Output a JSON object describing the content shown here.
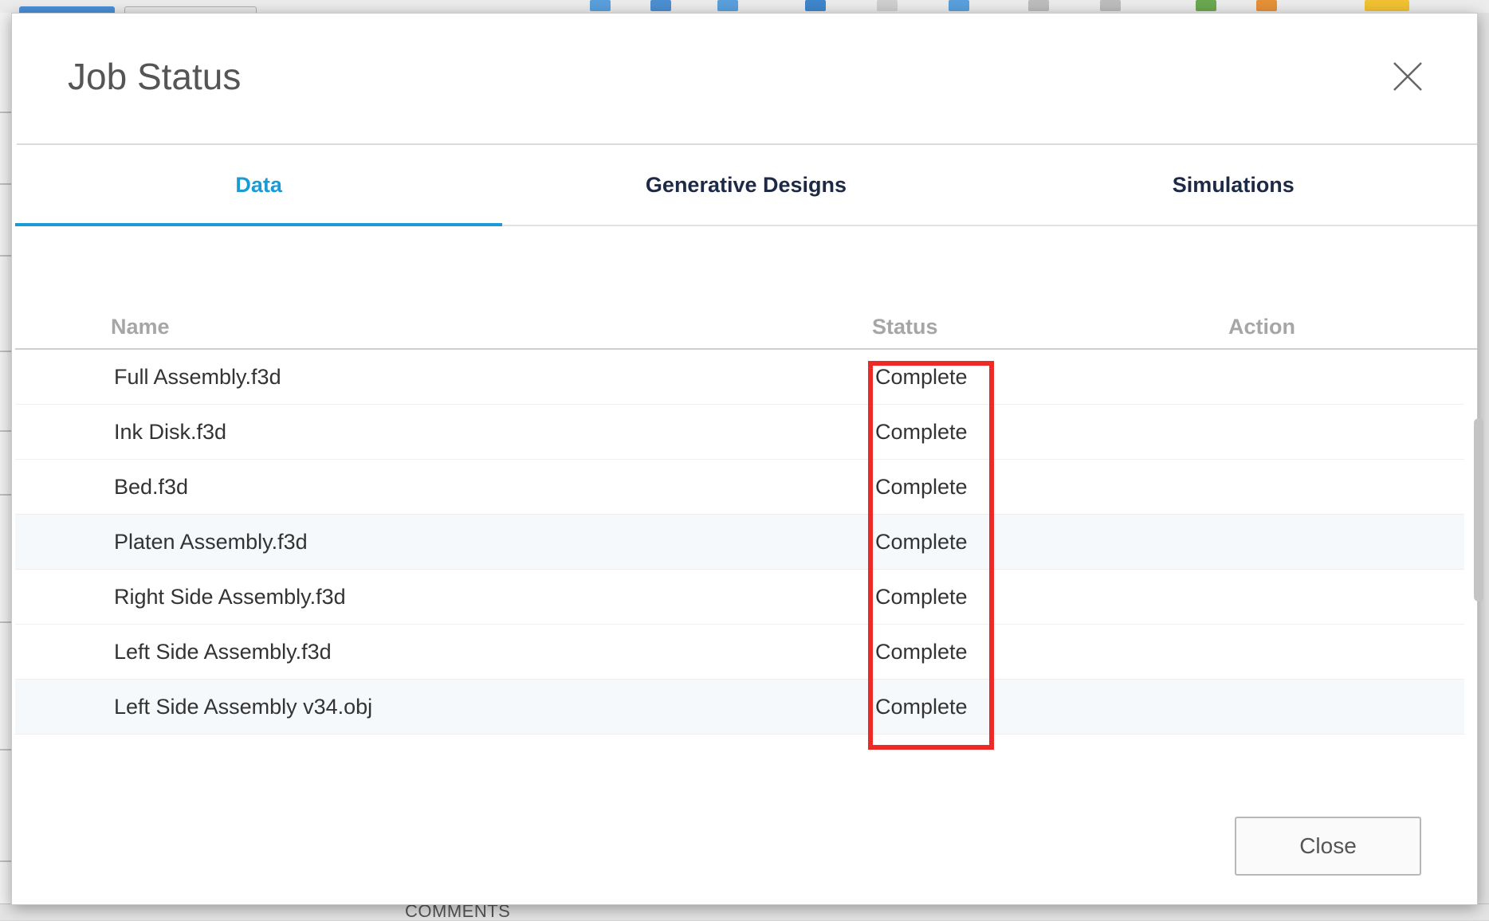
{
  "dialog": {
    "title": "Job Status",
    "close_icon": "close-x-icon"
  },
  "tabs": [
    {
      "label": "Data",
      "active": true
    },
    {
      "label": "Generative Designs",
      "active": false
    },
    {
      "label": "Simulations",
      "active": false
    }
  ],
  "table": {
    "headers": {
      "name": "Name",
      "status": "Status",
      "action": "Action"
    },
    "rows": [
      {
        "name": "Full Assembly.f3d",
        "status": "Complete"
      },
      {
        "name": "Ink Disk.f3d",
        "status": "Complete"
      },
      {
        "name": "Bed.f3d",
        "status": "Complete"
      },
      {
        "name": "Platen Assembly.f3d",
        "status": "Complete"
      },
      {
        "name": "Right Side Assembly.f3d",
        "status": "Complete"
      },
      {
        "name": "Left Side Assembly.f3d",
        "status": "Complete"
      },
      {
        "name": "Left Side Assembly v34.obj",
        "status": "Complete"
      }
    ]
  },
  "footer": {
    "close_label": "Close"
  },
  "background": {
    "comments_label": "COMMENTS"
  },
  "colors": {
    "accent": "#1b9ad6",
    "highlight": "#ef2a26",
    "tab_text": "#1e2a45",
    "header_text": "#a6a6a6"
  }
}
